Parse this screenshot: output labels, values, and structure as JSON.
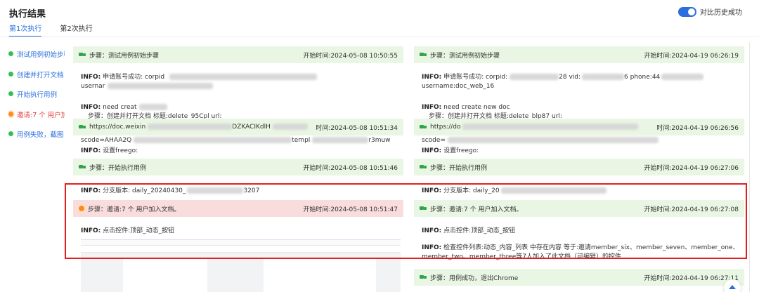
{
  "header": {
    "title": "执行结果",
    "compare_label": "对比历史成功"
  },
  "tabs": [
    {
      "label": "第1次执行"
    },
    {
      "label": "第2次执行"
    }
  ],
  "steps_nav": [
    {
      "label": "测试用例初始步骤",
      "status": "success"
    },
    {
      "label": "创建并打开文档",
      "status": "success"
    },
    {
      "label": "开始执行用例",
      "status": "success"
    },
    {
      "label": "邀请:7 个 用户加入文档。",
      "status": "fail"
    },
    {
      "label": "用例失败，截图",
      "status": "success"
    }
  ],
  "left": {
    "s1": {
      "label": "步骤：测试用例初始步骤",
      "time": "开始时间:2024-05-08 10:50:55"
    },
    "i1": {
      "prefix": "INFO:",
      "text": " 申请账号成功: corpid",
      "line2": "usernar"
    },
    "i2": {
      "prefix": "INFO:",
      "text": " need creat",
      "line2": "步骤：创建并打开文档 标题:delete_95Cpl url:"
    },
    "s2": {
      "text": "https://doc.weixin",
      "mid": "DZKACIKdlH",
      "time": "时间:2024-05-08 10:51:34"
    },
    "i2b": {
      "line": "scode=AHAA2Q",
      "end": "templ",
      "end2": "r3muw"
    },
    "i3": {
      "prefix": "INFO:",
      "text": " 设置freego:"
    },
    "s3": {
      "label": "步骤：开始执行用例",
      "time": "开始时间:2024-05-08 10:51:46"
    },
    "i4": {
      "prefix": "INFO:",
      "text": " 分支版本: daily_20240430_",
      "end": "3207"
    },
    "s4": {
      "label": "步骤：邀请:7 个 用户加入文档。",
      "time": "开始时间:2024-05-08 10:51:47"
    },
    "i5": {
      "prefix": "INFO:",
      "text": " 点击控件:顶部_动态_按钮"
    }
  },
  "right": {
    "s1": {
      "label": "步骤：测试用例初始步骤",
      "time": "开始时间:2024-04-19 06:26:19"
    },
    "i1": {
      "prefix": "INFO:",
      "text": " 申请账号成功: corpid:",
      "mid": "28  vid:",
      "end": "6  phone:44",
      "line2": "username:doc_web_16"
    },
    "i2": {
      "prefix": "INFO:",
      "text": " need create new doc",
      "line2": "步骤：创建并打开文档 标题:delete_blp87 url:"
    },
    "s2": {
      "text": "https://do",
      "time": "时间:2024-04-19 06:26:56"
    },
    "i2b": {
      "line": "scode="
    },
    "i3": {
      "prefix": "INFO:",
      "text": " 设置freego:"
    },
    "s3": {
      "label": "步骤：开始执行用例",
      "time": "开始时间:2024-04-19 06:27:06"
    },
    "i4": {
      "prefix": "INFO:",
      "text": " 分支版本: daily_20"
    },
    "s4": {
      "label": "步骤：邀请:7 个 用户加入文档。",
      "time": "开始时间:2024-04-19 06:27:08"
    },
    "i5": {
      "prefix": "INFO:",
      "text": " 点击控件:顶部_动态_按钮"
    },
    "i6": {
      "prefix": "INFO:",
      "text": " 检查控件列表:动态_内容_列表 中存在内容 等于:邀请member_six、member_seven、member_one、",
      "line2": "member_two、member_three等7人加入了此文档（可编辑）的控件"
    },
    "s5": {
      "label": "步骤：用例成功，退出Chrome",
      "time": "开始时间:2024-04-19 06:27:11"
    }
  },
  "colors": {
    "accent": "#2b6fde",
    "success_bg": "#e9f6e3",
    "fail_bg": "#f9dcdc",
    "highlight": "#e02020"
  }
}
